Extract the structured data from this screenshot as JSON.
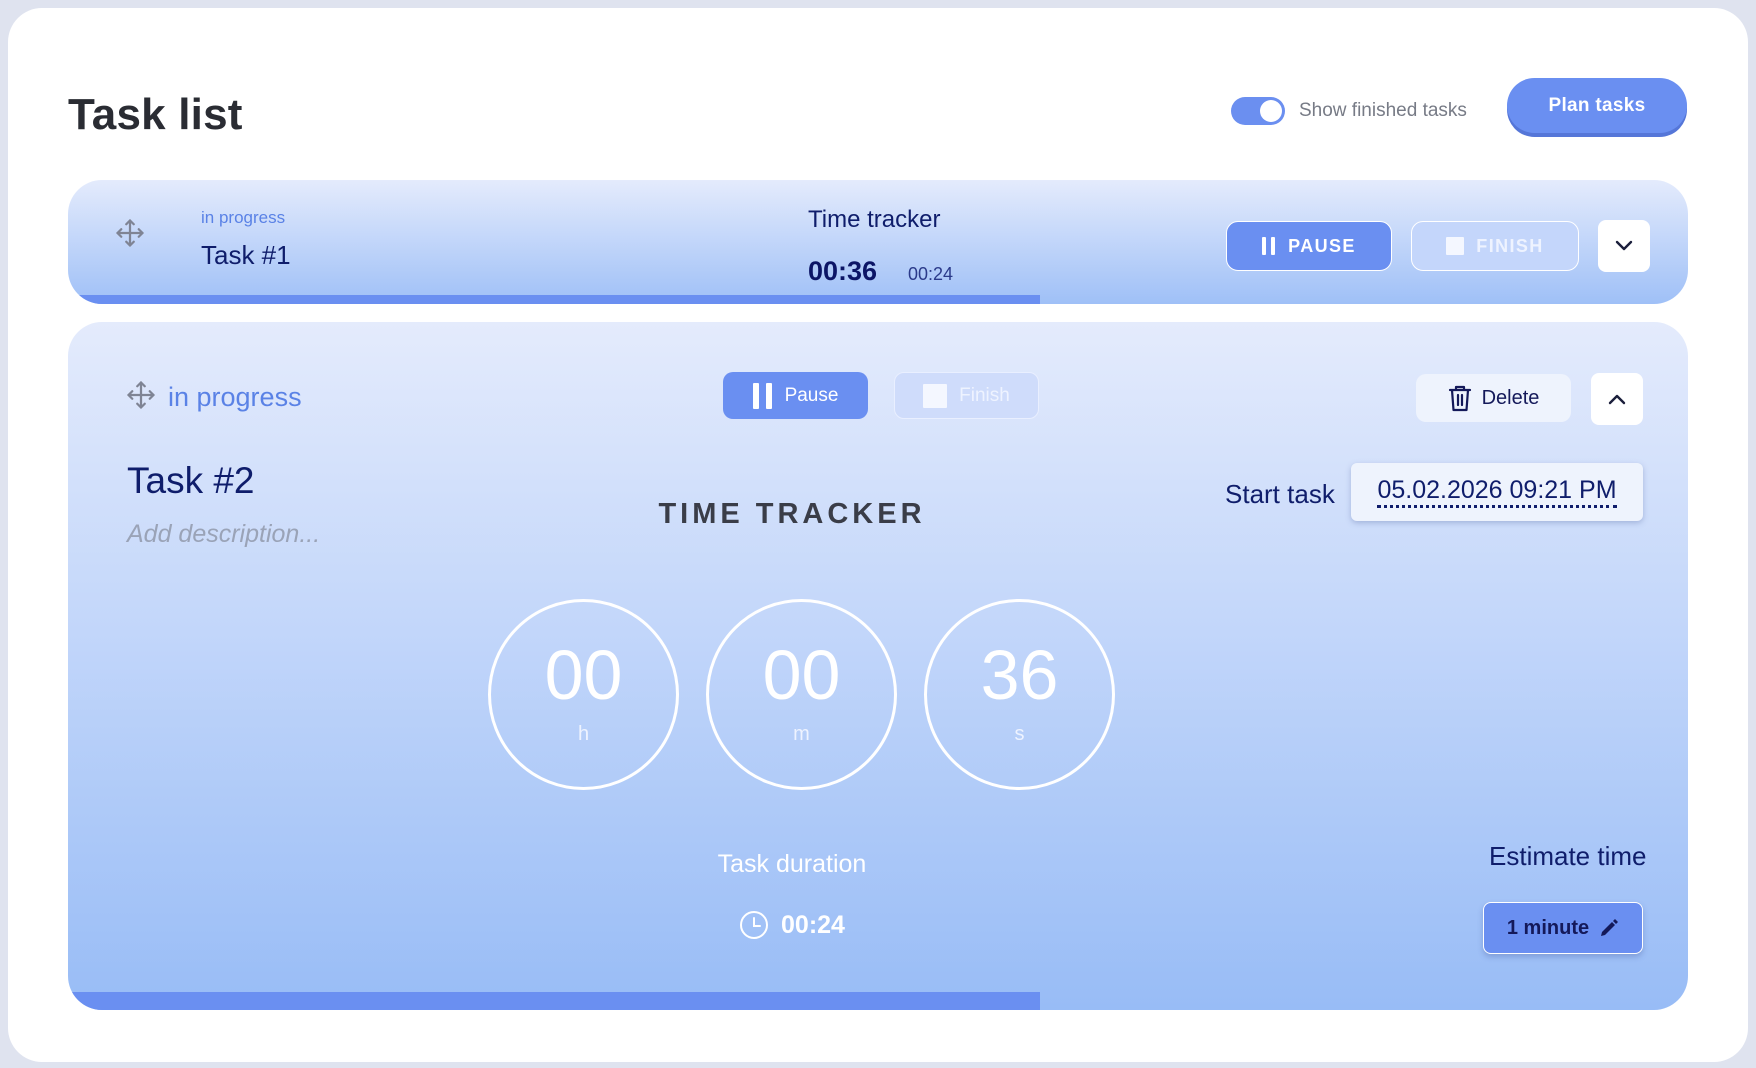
{
  "header": {
    "title": "Task list",
    "show_finished_label": "Show finished tasks",
    "show_finished_on": true,
    "plan_button": "Plan tasks"
  },
  "tasks": [
    {
      "status": "in progress",
      "name": "Task #1",
      "time_tracker_label": "Time tracker",
      "elapsed": "00:36",
      "estimate": "00:24",
      "pause_label": "PAUSE",
      "finish_label": "FINISH",
      "progress": 0.6,
      "expanded": false
    },
    {
      "status": "in progress",
      "name": "Task #2",
      "description_placeholder": "Add description...",
      "pause_label": "Pause",
      "finish_label": "Finish",
      "delete_label": "Delete",
      "time_tracker_title": "TIME TRACKER",
      "start_label": "Start task",
      "start_value": "05.02.2026 09:21 PM",
      "timer": {
        "hours": "00",
        "hours_unit": "h",
        "minutes": "00",
        "minutes_unit": "m",
        "seconds": "36",
        "seconds_unit": "s"
      },
      "duration_label": "Task duration",
      "duration_value": "00:24",
      "estimate_label": "Estimate time",
      "estimate_value": "1 minute",
      "progress": 0.6,
      "expanded": true
    }
  ],
  "colors": {
    "accent": "#6a8ff1",
    "text_dark": "#0f1d6b",
    "status": "#5a82e6"
  },
  "icons": [
    "move-icon",
    "pause-icon",
    "stop-icon",
    "chevron-down-icon",
    "chevron-up-icon",
    "trash-icon",
    "clock-icon",
    "pencil-icon"
  ]
}
